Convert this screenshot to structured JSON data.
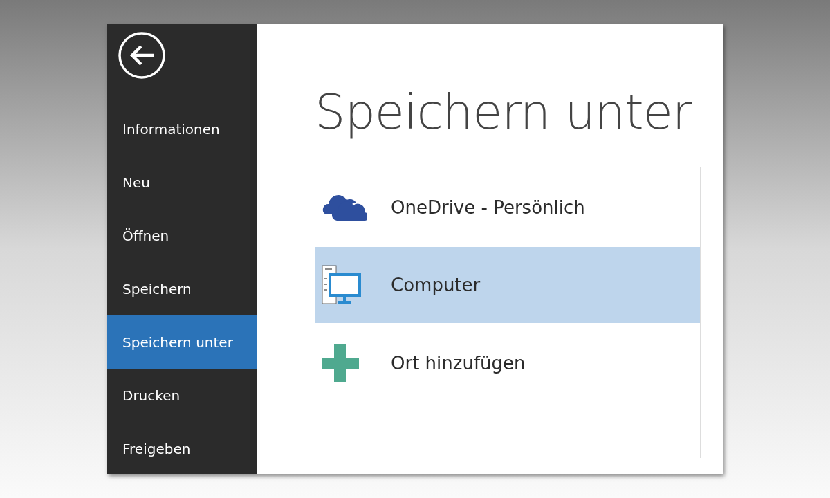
{
  "sidebar": {
    "items": [
      {
        "label": "Informationen",
        "selected": false
      },
      {
        "label": "Neu",
        "selected": false
      },
      {
        "label": "Öffnen",
        "selected": false
      },
      {
        "label": "Speichern",
        "selected": false
      },
      {
        "label": "Speichern unter",
        "selected": true
      },
      {
        "label": "Drucken",
        "selected": false
      },
      {
        "label": "Freigeben",
        "selected": false
      }
    ]
  },
  "heading": "Speichern unter",
  "places": [
    {
      "kind": "onedrive",
      "label": "OneDrive - Persönlich",
      "selected": false
    },
    {
      "kind": "computer",
      "label": "Computer",
      "selected": true
    },
    {
      "kind": "add",
      "label": "Ort hinzufügen",
      "selected": false
    }
  ]
}
